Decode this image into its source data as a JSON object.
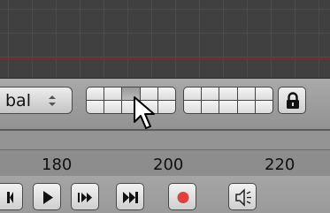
{
  "header": {
    "orientation_value": "bal",
    "layer_buttons_left": {
      "cells": 10,
      "active": [
        2
      ]
    },
    "layer_buttons_right": {
      "cells": 10,
      "active": []
    },
    "lock_icon": "lock-icon"
  },
  "timeline": {
    "ruler_ticks": [
      "180",
      "200",
      "220"
    ]
  },
  "playback": {
    "buttons": [
      "jump-start-icon",
      "play-icon",
      "next-keyframe-icon",
      "jump-end-icon",
      "record-icon",
      "audio-icon"
    ],
    "record_color": "#e04040"
  },
  "colors": {
    "viewport_bg": "#404040",
    "grid_line": "#4b4b4b",
    "x_axis": "#7a2c2c",
    "header_bg": "#a0a0a0"
  }
}
